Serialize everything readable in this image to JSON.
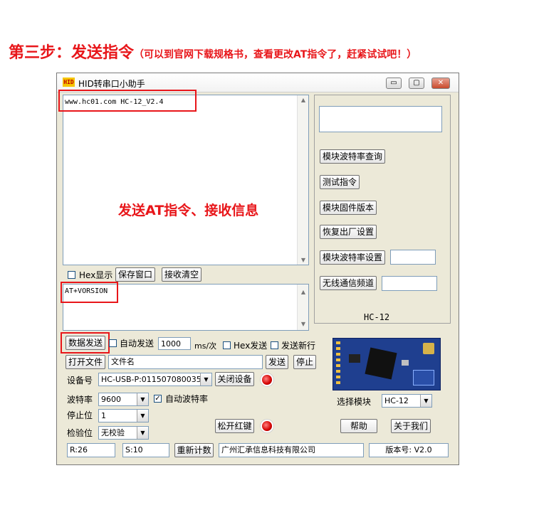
{
  "headline": {
    "main": "第三步：发送指令",
    "sub": "（可以到官网下载规格书，查看更改AT指令了，赶紧试试吧！）"
  },
  "window": {
    "icon_text": "HID",
    "title": "HID转串口小助手",
    "buttons": {
      "minimize": "▭",
      "maximize": "▢",
      "close": "✕"
    }
  },
  "receive": {
    "text": "www.hc01.com  HC-12_V2.4"
  },
  "annotation": "发送AT指令、接收信息",
  "recv_options": {
    "hex_display": "Hex显示",
    "save_window": "保存窗口",
    "clear_recv": "接收清空"
  },
  "send": {
    "text": "AT+VORSION"
  },
  "send_options": {
    "send_data": "数据发送",
    "auto_send": "自动发送",
    "interval": "1000",
    "interval_unit": "ms/次",
    "hex_send": "Hex发送",
    "send_newline": "发送新行"
  },
  "file_row": {
    "open_file": "打开文件",
    "file_name": "文件名",
    "send": "发送",
    "stop": "停止"
  },
  "device": {
    "label": "设备号",
    "value": "HC-USB-P:011507080035",
    "close_device": "关闭设备"
  },
  "baud": {
    "label": "波特率",
    "value": "9600",
    "auto_baud": "自动波特率"
  },
  "stopbit": {
    "label": "停止位",
    "value": "1"
  },
  "parity": {
    "label": "检验位",
    "value": "无校验"
  },
  "release_red_key": "松开红键",
  "right_panel": {
    "query_baud": "模块波特率查询",
    "test_cmd": "测试指令",
    "firmware_version": "模块固件版本",
    "factory_reset": "恢复出厂设置",
    "set_baud": "模块波特率设置",
    "wireless_channel": "无线通信频道",
    "module_name": "HC-12"
  },
  "module_select": {
    "label": "选择模块",
    "value": "HC-12"
  },
  "help": "帮助",
  "about": "关于我们",
  "statusbar": {
    "recv_count": "R:26",
    "send_count": "S:10",
    "recount": "重新计数",
    "company": "广州汇承信息科技有限公司",
    "version": "版本号: V2.0"
  },
  "colors": {
    "accent_red": "#e8161a",
    "window_bg": "#ece9d8",
    "board_blue": "#1f3f8f"
  }
}
